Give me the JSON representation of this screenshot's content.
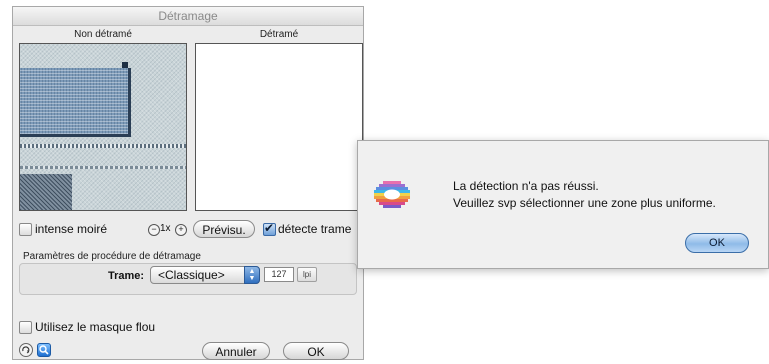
{
  "dialog": {
    "title": "Détramage",
    "pane_left_label": "Non détramé",
    "pane_right_label": "Détramé",
    "intense_moire_label": "intense moiré",
    "zoom_label": "1x",
    "preview_button": "Prévisu.",
    "detect_label": "détecte trame",
    "group_title": "Paramètres de procédure de détramage",
    "trame_label": "Trame:",
    "trame_value": "<Classique>",
    "lpi_value": "127",
    "lpi_unit": "lpi",
    "blur_mask_label": "Utilisez le masque flou",
    "cancel_button": "Annuler",
    "ok_button": "OK",
    "detect_checked": true,
    "intense_moire_checked": false,
    "blur_mask_checked": false
  },
  "alert": {
    "line1": "La détection n'a pas réussi.",
    "line2": "Veuillez svp sélectionner une zone plus uniforme.",
    "ok_button": "OK"
  },
  "icons": {
    "zoom_out": "zoom-out-icon",
    "zoom_in": "zoom-in-icon",
    "popup_arrows": "up-down-arrows-icon",
    "help": "help-icon",
    "magnifier": "magnifier-icon",
    "alert": "eye-logo-icon"
  },
  "colors": {
    "accent": "#6fa0d8",
    "ok_button": "#8fbbe8"
  }
}
